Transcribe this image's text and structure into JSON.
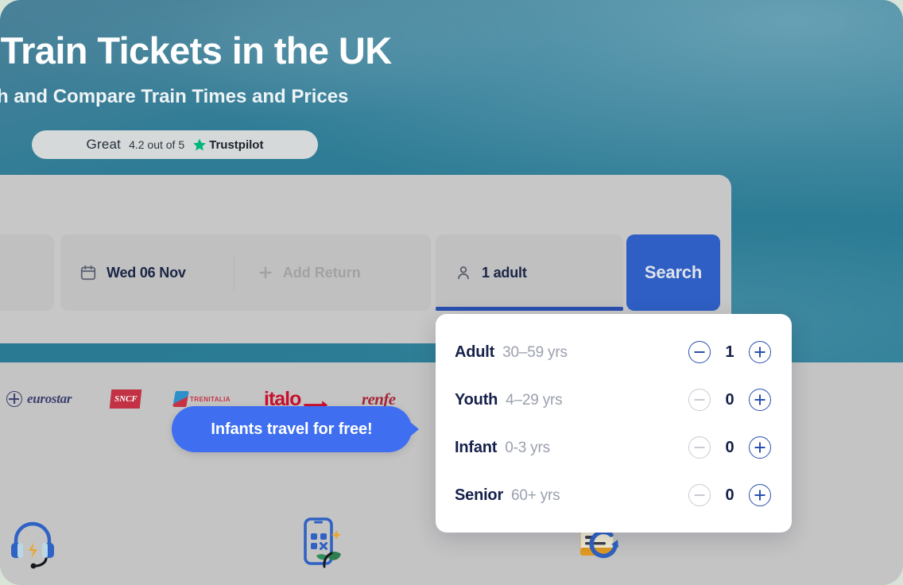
{
  "hero": {
    "title": "p Train Tickets in the UK",
    "subtitle": "arch and Compare Train Times and Prices",
    "bg_color": "#2a7a93"
  },
  "trustpilot": {
    "rating_word": "Great",
    "score_text": "4.2 out of 5",
    "brand_name": "Trustpilot",
    "star_color": "#00b67a"
  },
  "search_form": {
    "date_label": "Wed 06 Nov",
    "add_return_label": "Add Return",
    "passengers_label": "1 adult",
    "search_button_label": "Search",
    "accent_color": "#2f5fc4",
    "focus_underline_color": "#2a4fae",
    "icons": {
      "date": "calendar-icon",
      "add_return": "plus-icon",
      "passengers": "person-icon"
    }
  },
  "passenger_panel": {
    "rows": [
      {
        "type": "Adult",
        "age_range": "30–59 yrs",
        "count": "1",
        "minus_enabled": true,
        "plus_enabled": true
      },
      {
        "type": "Youth",
        "age_range": "4–29 yrs",
        "count": "0",
        "minus_enabled": false,
        "plus_enabled": true
      },
      {
        "type": "Infant",
        "age_range": "0-3 yrs",
        "count": "0",
        "minus_enabled": false,
        "plus_enabled": true
      },
      {
        "type": "Senior",
        "age_range": "60+ yrs",
        "count": "0",
        "minus_enabled": false,
        "plus_enabled": true
      }
    ],
    "minus_icon": "minus-circle-icon",
    "plus_icon": "plus-circle-icon",
    "active_color": "#2a4fae",
    "disabled_color": "#c9ccd6"
  },
  "tooltip": {
    "text": "Infants travel for free!",
    "color": "#3f6ff0"
  },
  "brands": [
    {
      "name": "eurostar",
      "color": "#3b3f6e"
    },
    {
      "name": "SNCF",
      "color": "#c33145"
    },
    {
      "name": "TRENITALIA",
      "color": "#c43244"
    },
    {
      "name": "italo",
      "color": "#c8102e"
    },
    {
      "name": "renfe",
      "color": "#a32638"
    }
  ],
  "features": [
    {
      "icon": "headset-support-icon"
    },
    {
      "icon": "mobile-qr-eco-icon"
    },
    {
      "icon": "ticket-refund-icon"
    }
  ]
}
